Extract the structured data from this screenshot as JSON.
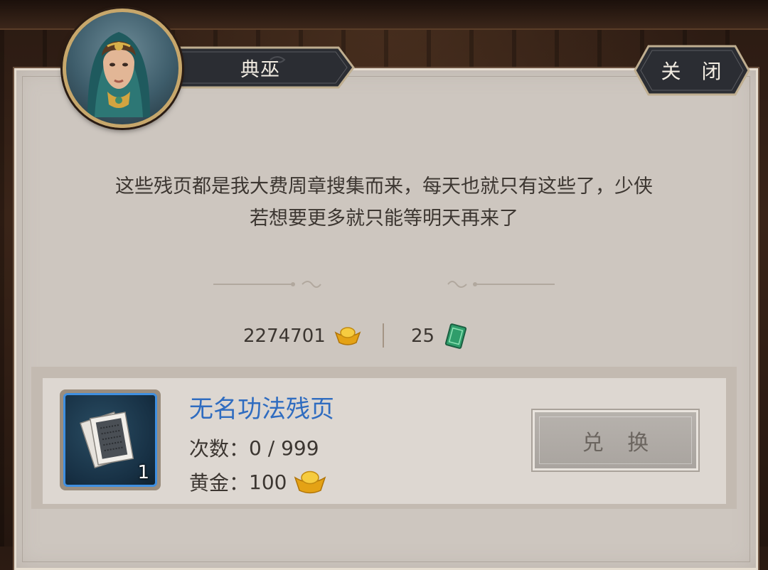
{
  "npc": {
    "name": "典巫",
    "portrait": "hooded-woman-portrait"
  },
  "header": {
    "close_label": "关 闭"
  },
  "dialog": {
    "line1": "这些残页都是我大费周章搜集而来，每天也就只有这些了，少侠",
    "line2": "若想要更多就只能等明天再来了"
  },
  "currencies": {
    "gold": {
      "amount": "2274701",
      "icon": "gold-ingot-icon"
    },
    "jade": {
      "amount": "25",
      "icon": "jade-token-icon"
    }
  },
  "shop_items": [
    {
      "name": "无名功法残页",
      "icon": "scroll-pages-icon",
      "stack_count": "1",
      "times_label": "次数：",
      "times_value": "0 / 999",
      "price_label": "黄金：",
      "price_value": "100",
      "price_icon": "gold-ingot-icon",
      "button_label": "兑 换"
    }
  ],
  "colors": {
    "panel": "#cdc6bf",
    "item_name": "#2f6cc0",
    "plate": "#2b2d33",
    "icon_border": "#3f8fe0"
  }
}
